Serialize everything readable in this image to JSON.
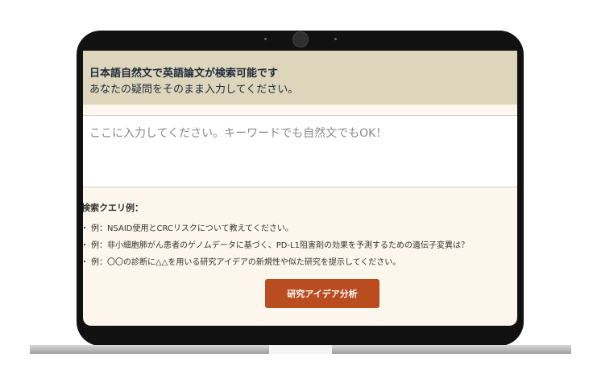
{
  "header": {
    "title": "日本語自然文で英語論文が検索可能です",
    "subtitle": "あなたの疑問をそのまま入力してください。"
  },
  "query_input": {
    "placeholder": "ここに入力してください。キーワードでも自然文でもOK！",
    "value": ""
  },
  "examples": {
    "heading": "検索クエリ例：",
    "bullet": "・",
    "items": [
      "例：NSAID使用とCRCリスクについて教えてください。",
      "例：非小細胞肺がん患者のゲノムデータに基づく、PD-L1阻害剤の効果を予測するための遺伝子変異は？",
      "例：〇〇の診断に△△を用いる研究アイデアの新規性や似た研究を提示してください。"
    ]
  },
  "action_button": {
    "label": "研究アイデア分析"
  },
  "colors": {
    "header_bg": "#ddd5bc",
    "page_bg": "#fdf6ec",
    "accent": "#b94d1f",
    "bezel": "#111111"
  }
}
